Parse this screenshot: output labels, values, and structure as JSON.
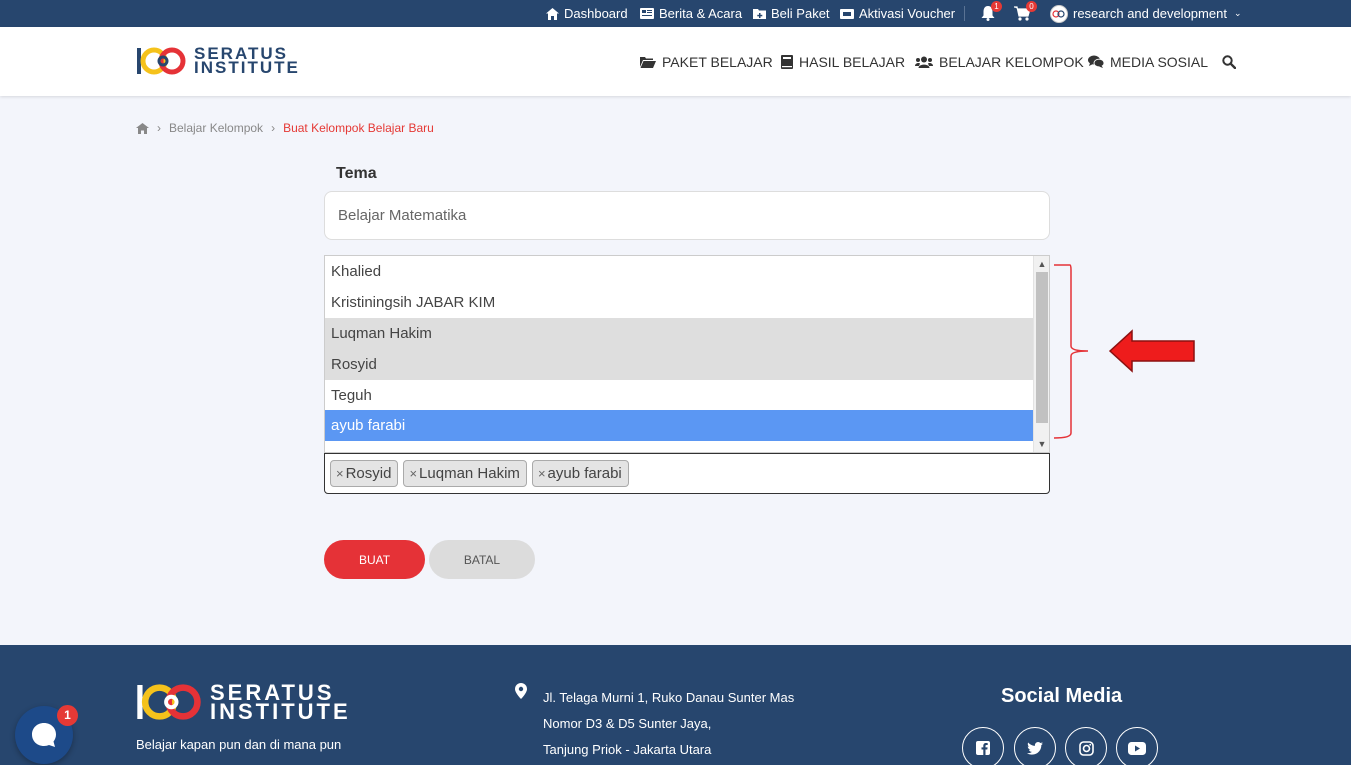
{
  "topbar": {
    "dashboard": "Dashboard",
    "berita": "Berita & Acara",
    "beli_paket": "Beli Paket",
    "aktivasi": "Aktivasi Voucher",
    "notif_count": "1",
    "cart_count": "0",
    "user_name": "research and development"
  },
  "brand": {
    "line1": "SERATUS",
    "line2": "INSTITUTE"
  },
  "nav": {
    "paket": "PAKET BELAJAR",
    "hasil": "HASIL BELAJAR",
    "kelompok": "BELAJAR KELOMPOK",
    "media": "MEDIA SOSIAL"
  },
  "breadcrumb": {
    "item1": "Belajar Kelompok",
    "current": "Buat Kelompok Belajar Baru"
  },
  "form": {
    "tema_label": "Tema",
    "tema_value": "Belajar Matematika",
    "options": [
      "Khalied",
      "Kristiningsih JABAR KIM",
      "Luqman Hakim",
      "Rosyid",
      "Teguh",
      "ayub farabi"
    ],
    "tags": [
      "Rosyid",
      "Luqman Hakim",
      "ayub farabi"
    ],
    "buat": "BUAT",
    "batal": "BATAL"
  },
  "footer": {
    "tagline": "Belajar kapan pun dan di mana pun",
    "address_1": "Jl. Telaga Murni 1, Ruko Danau Sunter Mas",
    "address_2": "Nomor D3 & D5 Sunter Jaya,",
    "address_3": "Tanjung Priok - Jakarta Utara",
    "social_title": "Social Media"
  },
  "chat": {
    "badge": "1"
  },
  "colors": {
    "navy": "#27466e",
    "accent": "#e53237",
    "selected": "#5b97f3"
  }
}
